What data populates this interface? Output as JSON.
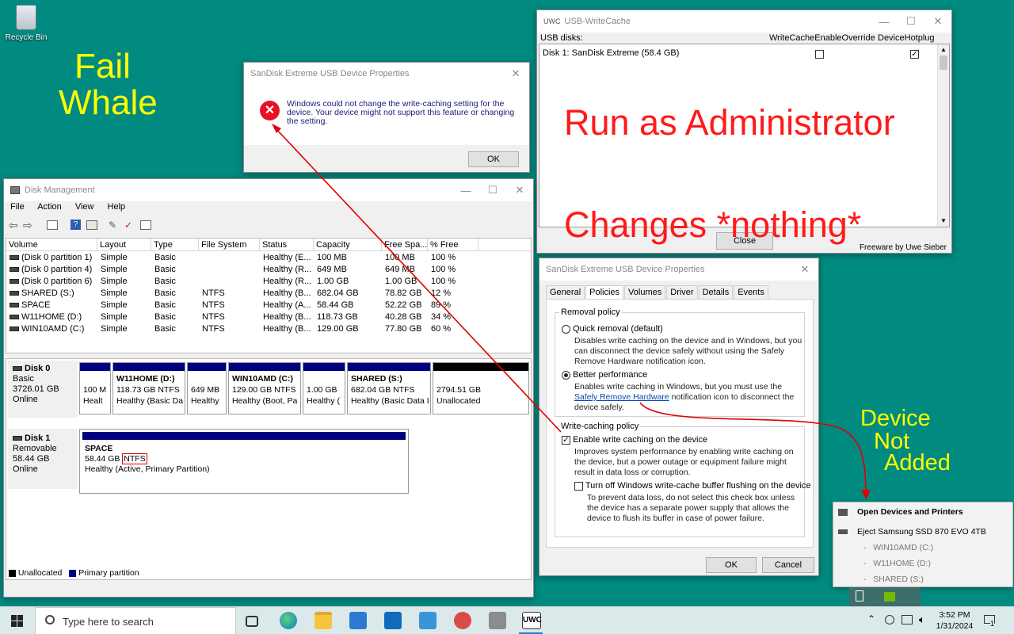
{
  "desktop": {
    "recycle_bin_label": "Recycle Bin"
  },
  "annotations": {
    "fail_whale_line1": "Fail",
    "fail_whale_line2": "Whale",
    "run_as_admin": "Run as Administrator",
    "changes_nothing": "Changes *nothing*",
    "device_line1": "Device",
    "device_line2": "Not",
    "device_line3": "Added",
    "colors": {
      "yellow": "#ffff00",
      "red": "#ff1a1a",
      "arrow": "#e00000"
    }
  },
  "error_dialog": {
    "title": "SanDisk Extreme USB Device Properties",
    "message": "Windows could not change the write-caching setting for the device. Your device might not support this feature or changing the setting.",
    "ok_label": "OK",
    "icon": "error-icon"
  },
  "usb_writecache": {
    "title": "USB-WriteCache",
    "app_badge": "UWC",
    "usb_disks_label": "USB disks:",
    "col_override": "WriteCacheEnableOverride",
    "col_hotplug": "DeviceHotplug",
    "disk_row": "Disk 1:  SanDisk Extreme  (58.4 GB)",
    "override_checked": false,
    "hotplug_checked": true,
    "close_label": "Close",
    "footer": "Freeware by Uwe Sieber"
  },
  "disk_mgmt": {
    "title": "Disk Management",
    "menu": [
      "File",
      "Action",
      "View",
      "Help"
    ],
    "columns": [
      "Volume",
      "Layout",
      "Type",
      "File System",
      "Status",
      "Capacity",
      "Free Spa...",
      "% Free"
    ],
    "rows": [
      [
        "(Disk 0 partition 1)",
        "Simple",
        "Basic",
        "",
        "Healthy (E...",
        "100 MB",
        "100 MB",
        "100 %"
      ],
      [
        "(Disk 0 partition 4)",
        "Simple",
        "Basic",
        "",
        "Healthy (R...",
        "649 MB",
        "649 MB",
        "100 %"
      ],
      [
        "(Disk 0 partition 6)",
        "Simple",
        "Basic",
        "",
        "Healthy (R...",
        "1.00 GB",
        "1.00 GB",
        "100 %"
      ],
      [
        "SHARED (S:)",
        "Simple",
        "Basic",
        "NTFS",
        "Healthy (B...",
        "682.04 GB",
        "78.82 GB",
        "12 %"
      ],
      [
        "SPACE",
        "Simple",
        "Basic",
        "NTFS",
        "Healthy (A...",
        "58.44 GB",
        "52.22 GB",
        "89 %"
      ],
      [
        "W11HOME (D:)",
        "Simple",
        "Basic",
        "NTFS",
        "Healthy (B...",
        "118.73 GB",
        "40.28 GB",
        "34 %"
      ],
      [
        "WIN10AMD (C:)",
        "Simple",
        "Basic",
        "NTFS",
        "Healthy (B...",
        "129.00 GB",
        "77.80 GB",
        "60 %"
      ]
    ],
    "disk0": {
      "name": "Disk 0",
      "type": "Basic",
      "size": "3726.01 GB",
      "state": "Online",
      "parts": [
        {
          "name": "",
          "size": "100 M",
          "status": "Healt"
        },
        {
          "name": "W11HOME  (D:)",
          "size": "118.73 GB NTFS",
          "status": "Healthy (Basic Da"
        },
        {
          "name": "",
          "size": "649 MB",
          "status": "Healthy"
        },
        {
          "name": "WIN10AMD  (C:)",
          "size": "129.00 GB NTFS",
          "status": "Healthy (Boot, Pa"
        },
        {
          "name": "",
          "size": "1.00 GB",
          "status": "Healthy ("
        },
        {
          "name": "SHARED  (S:)",
          "size": "682.04 GB NTFS",
          "status": "Healthy (Basic Data I"
        },
        {
          "name": "",
          "size": "2794.51 GB",
          "status": "Unallocated"
        }
      ]
    },
    "disk1": {
      "name": "Disk 1",
      "type": "Removable",
      "size": "58.44 GB",
      "state": "Online",
      "part_name": "SPACE",
      "part_size": "58.44 GB",
      "part_fs": "NTFS",
      "part_status": "Healthy (Active, Primary Partition)"
    },
    "legend_unallocated": "Unallocated",
    "legend_primary": "Primary partition"
  },
  "props_dialog": {
    "title": "SanDisk Extreme USB Device Properties",
    "tabs": [
      "General",
      "Policies",
      "Volumes",
      "Driver",
      "Details",
      "Events"
    ],
    "active_tab": "Policies",
    "removal_policy": "Removal policy",
    "quick_removal": "Quick removal (default)",
    "quick_desc": "Disables write caching on the device and in Windows, but you can disconnect the device safely without using the Safely Remove Hardware notification icon.",
    "better_perf": "Better performance",
    "better_desc_1": "Enables write caching in Windows, but you must use the",
    "better_link": "Safely Remove Hardware",
    "better_desc_2": "notification icon to disconnect the device safely.",
    "write_policy": "Write-caching policy",
    "enable_wc": "Enable write caching on the device",
    "enable_desc": "Improves system performance by enabling write caching on the device, but a power outage or equipment failure might result in data loss or corruption.",
    "turn_off": "Turn off Windows write-cache buffer flushing on the device",
    "turn_off_desc": "To prevent data loss, do not select this check box unless the device has a separate power supply that allows the device to flush its buffer in case of power failure.",
    "ok_label": "OK",
    "cancel_label": "Cancel"
  },
  "tray_popup": {
    "open_devices": "Open Devices and Printers",
    "eject": "Eject Samsung SSD 870 EVO 4TB",
    "volumes": [
      "WIN10AMD (C:)",
      "W11HOME (D:)",
      "SHARED (S:)"
    ]
  },
  "taskbar": {
    "search_placeholder": "Type here to search",
    "time": "3:52 PM",
    "date": "1/31/2024",
    "notification_count": "1",
    "uwc_label": "UWC"
  }
}
